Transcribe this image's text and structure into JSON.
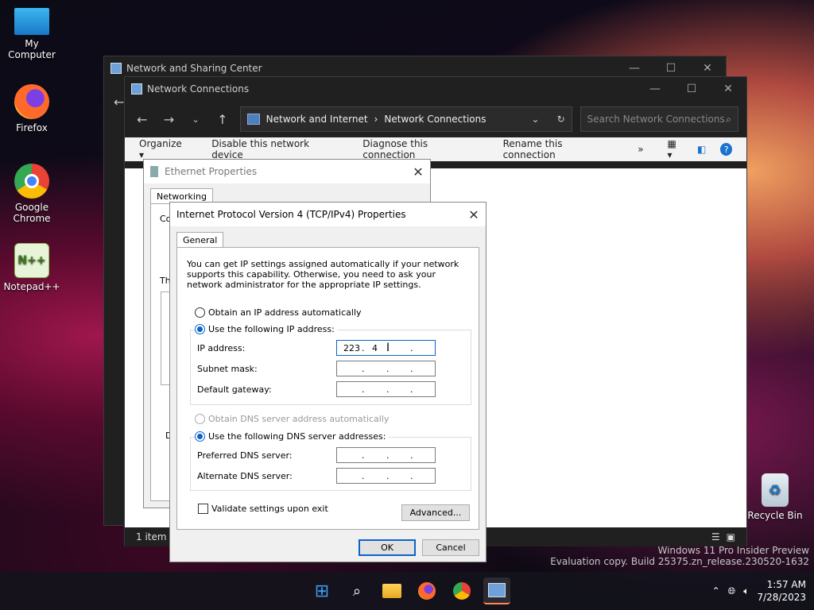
{
  "desktop": {
    "icons": [
      {
        "label": "My Computer",
        "icon": "monitor-icon"
      },
      {
        "label": "Firefox",
        "icon": "firefox-icon"
      },
      {
        "label": "Google Chrome",
        "icon": "chrome-icon"
      },
      {
        "label": "Notepad++",
        "icon": "notepadpp-icon"
      },
      {
        "label": "Recycle Bin",
        "icon": "recycle-bin-icon"
      }
    ],
    "watermark": {
      "line1": "Windows 11 Pro Insider Preview",
      "line2": "Evaluation copy. Build 25375.zn_release.230520-1632"
    }
  },
  "sharing_center": {
    "title": "Network and Sharing Center"
  },
  "network_connections": {
    "title": "Network Connections",
    "breadcrumb": [
      "Network and Internet",
      "Network Connections"
    ],
    "search_placeholder": "Search Network Connections",
    "commands": [
      "Organize ▾",
      "Disable this network device",
      "Diagnose this connection",
      "Rename this connection",
      "»"
    ],
    "status": "1 item"
  },
  "ethernet_properties": {
    "title": "Ethernet Properties",
    "tab": "Networking",
    "partial_labels": [
      "Co",
      "Thi",
      "D"
    ]
  },
  "ipv4_dialog": {
    "title": "Internet Protocol Version 4 (TCP/IPv4) Properties",
    "tab": "General",
    "description": "You can get IP settings assigned automatically if your network supports this capability. Otherwise, you need to ask your network administrator for the appropriate IP settings.",
    "ip_auto": "Obtain an IP address automatically",
    "ip_manual": "Use the following IP address:",
    "ip_address_label": "IP address:",
    "ip_address_value": [
      "223",
      "4",
      "",
      ""
    ],
    "subnet_label": "Subnet mask:",
    "gateway_label": "Default gateway:",
    "dns_auto": "Obtain DNS server address automatically",
    "dns_manual": "Use the following DNS server addresses:",
    "preferred_dns_label": "Preferred DNS server:",
    "alternate_dns_label": "Alternate DNS server:",
    "validate_label": "Validate settings upon exit",
    "advanced_label": "Advanced...",
    "ok_label": "OK",
    "cancel_label": "Cancel"
  },
  "taskbar": {
    "time": "1:57 AM",
    "date": "7/28/2023"
  }
}
